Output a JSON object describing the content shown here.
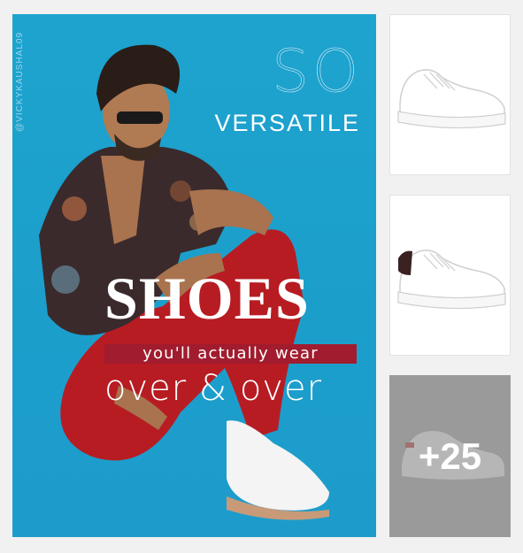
{
  "poster": {
    "watermark": "@VICKYKAUSHAL09",
    "headline_so": "SO",
    "headline_versatile": "VERSATILE",
    "headline_shoes": "SHOES",
    "tagline": "you'll actually wear",
    "subline": "over & over"
  },
  "sidebar": {
    "items": [
      {
        "name": "white-sneaker"
      },
      {
        "name": "white-sneaker-black-heel"
      },
      {
        "name": "sneaker-more"
      }
    ],
    "more_count": "+25"
  },
  "colors": {
    "poster_bg": "#1ea3cf",
    "tagline_bg": "#a11c2e",
    "more_overlay": "#9a9a9a"
  }
}
